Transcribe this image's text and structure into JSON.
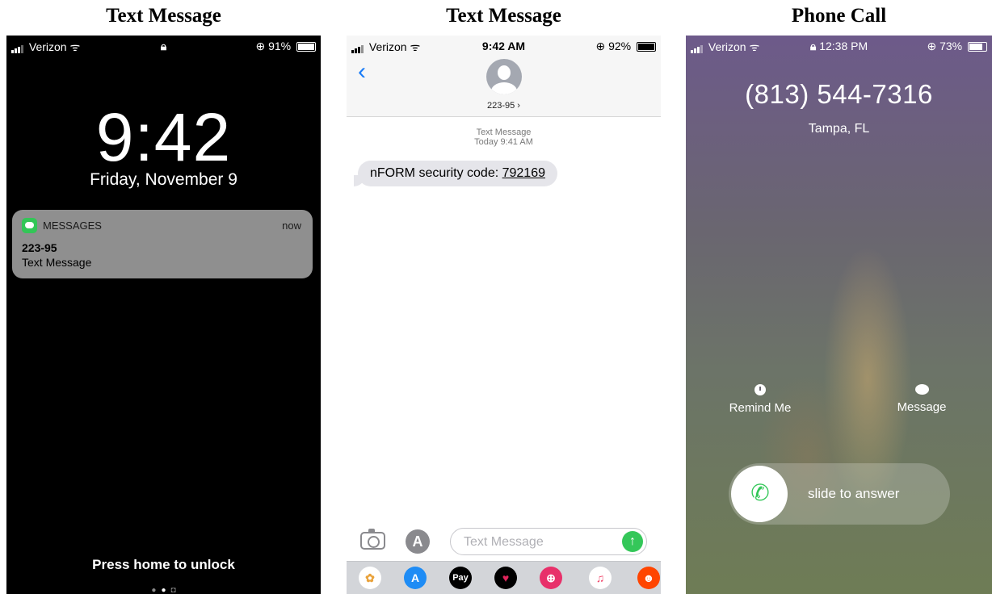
{
  "captions": [
    "Text Message",
    "Text Message",
    "Phone Call"
  ],
  "lock_screen": {
    "status": {
      "carrier": "Verizon",
      "battery": "91%",
      "battery_level": 0.91
    },
    "time": "9:42",
    "date": "Friday, November 9",
    "notification": {
      "app": "MESSAGES",
      "time": "now",
      "sender": "223-95",
      "body": "Text Message"
    },
    "unlock_hint": "Press home to unlock"
  },
  "messages_app": {
    "status": {
      "carrier": "Verizon",
      "time": "9:42 AM",
      "battery": "92%",
      "battery_level": 0.92
    },
    "contact": "223-95 ›",
    "thread_label": "Text Message",
    "thread_time": "Today 9:41 AM",
    "message_prefix": "nFORM security code: ",
    "message_code": "792169",
    "input_placeholder": "Text Message",
    "dock_apps": [
      {
        "icon": "photos-icon",
        "color": "#ffffff"
      },
      {
        "icon": "app-store-icon",
        "color": "#1e8cf5"
      },
      {
        "icon": "apple-pay-icon",
        "color": "#000000"
      },
      {
        "icon": "digital-touch-icon",
        "color": "#e1245b"
      },
      {
        "icon": "music-search-icon",
        "color": "#e8306a"
      },
      {
        "icon": "music-icon",
        "color": "#ffffff"
      },
      {
        "icon": "reddit-icon",
        "color": "#ff4500"
      }
    ],
    "apple_pay_label": "Pay"
  },
  "phone_call": {
    "status": {
      "carrier": "Verizon",
      "time": "12:38 PM",
      "battery": "73%",
      "battery_level": 0.73
    },
    "number": "(813) 544-7316",
    "location": "Tampa, FL",
    "remind_label": "Remind Me",
    "message_label": "Message",
    "slider_label": "slide to answer"
  }
}
